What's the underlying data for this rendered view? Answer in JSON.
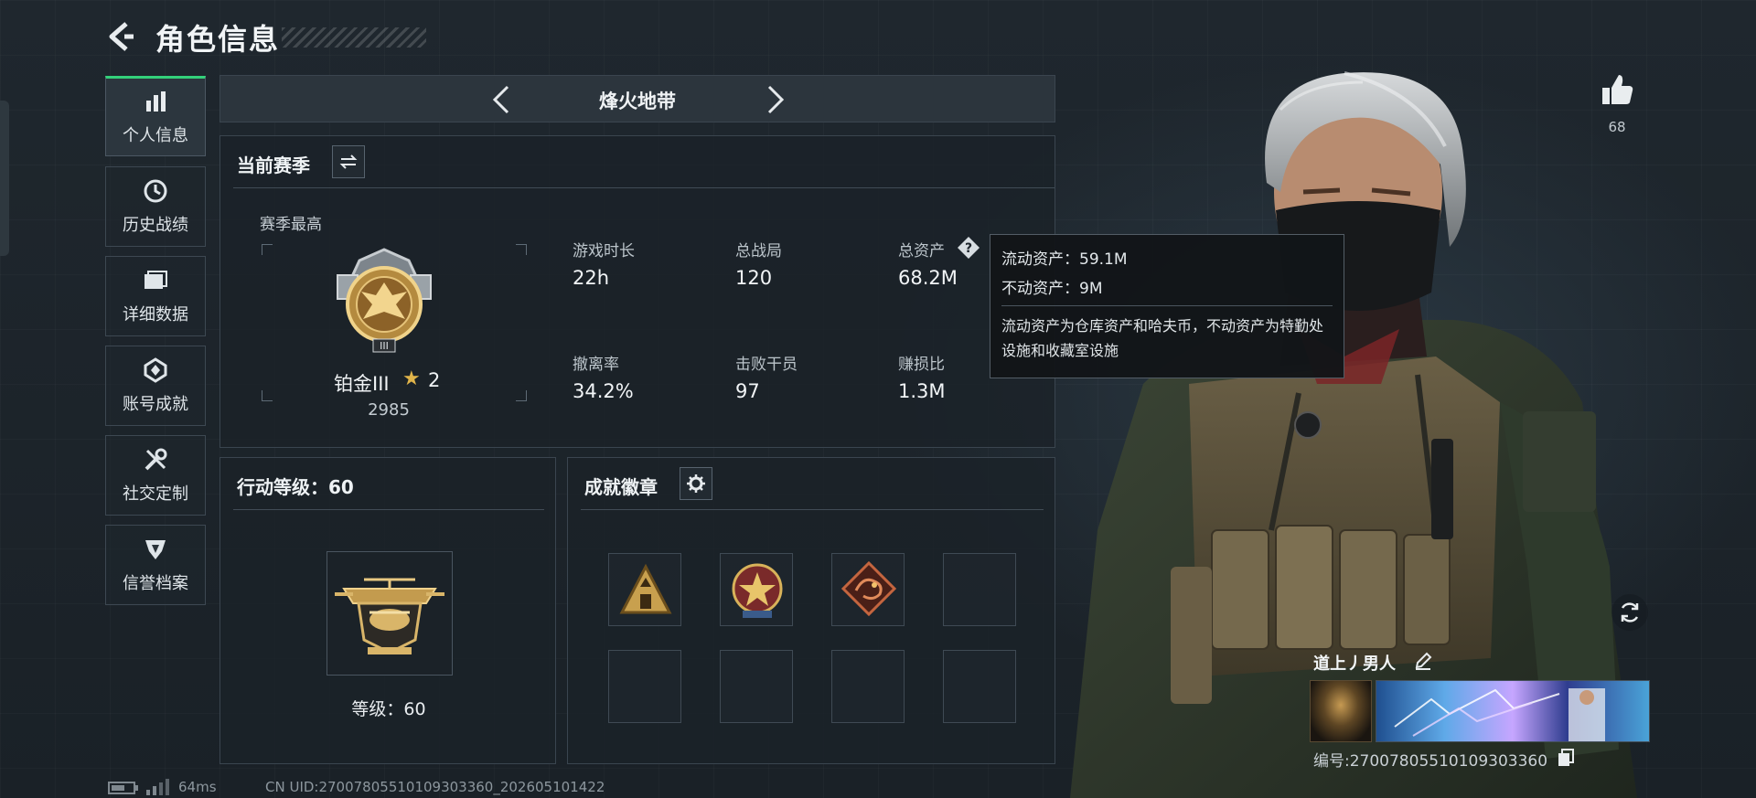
{
  "header": {
    "title": "角色信息"
  },
  "sidebar": {
    "items": [
      {
        "label": "个人信息",
        "icon": "bar-chart-icon",
        "active": true
      },
      {
        "label": "历史战绩",
        "icon": "history-icon",
        "active": false
      },
      {
        "label": "详细数据",
        "icon": "folder-icon",
        "active": false
      },
      {
        "label": "账号成就",
        "icon": "achievement-icon",
        "active": false
      },
      {
        "label": "社交定制",
        "icon": "tools-icon",
        "active": false
      },
      {
        "label": "信誉档案",
        "icon": "reputation-icon",
        "active": false
      }
    ]
  },
  "mode": {
    "title": "烽火地带"
  },
  "season": {
    "title": "当前赛季",
    "best_label": "赛季最高",
    "rank_name": "铂金III",
    "rank_stars": "2",
    "rank_score": "2985",
    "stats": [
      {
        "label": "游戏时长",
        "value": "22h"
      },
      {
        "label": "总战局",
        "value": "120"
      },
      {
        "label": "总资产",
        "value": "68.2M"
      },
      {
        "label": "撤离率",
        "value": "34.2%"
      },
      {
        "label": "击败干员",
        "value": "97"
      },
      {
        "label": "赚损比",
        "value": "1.3M"
      }
    ]
  },
  "tooltip": {
    "liquid": "流动资产：59.1M",
    "fixed": "不动资产：9M",
    "note": "流动资产为仓库资产和哈夫币，不动资产为特勤处设施和收藏室设施"
  },
  "action_level": {
    "title": "行动等级：60",
    "level_text": "等级：60"
  },
  "badges": {
    "title": "成就徽章",
    "slots": [
      "triangle-badge",
      "star-badge",
      "dragon-badge",
      "empty",
      "empty",
      "empty",
      "empty",
      "empty"
    ]
  },
  "profile": {
    "likes": "68",
    "player_name": "道上丿男人",
    "player_id": "编号:2700780551010930336​0"
  },
  "status": {
    "ping": "64ms",
    "uid": "CN UID:270078055101093033​60_202605101422"
  },
  "colors": {
    "accent": "#33d17a",
    "gold": "#e0b44a",
    "panel_border": "#3a454f"
  }
}
